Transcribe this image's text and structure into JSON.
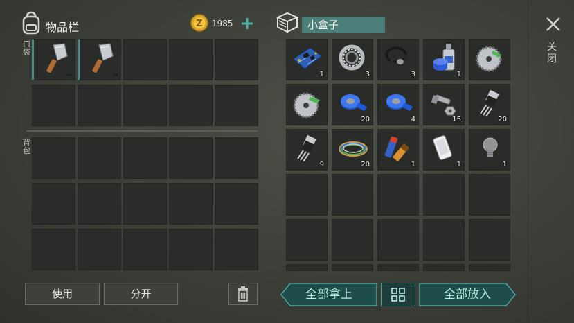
{
  "inventory": {
    "title": "物品栏",
    "coins": "1985",
    "pocket_label": "口袋",
    "backpack_label": "背包",
    "pocket_items": [
      {
        "icon": "cleaver-icon"
      },
      {
        "icon": "cleaver-icon"
      }
    ]
  },
  "container": {
    "title": "小盒子",
    "items": [
      {
        "icon": "circuit-board-icon",
        "qty": "1"
      },
      {
        "icon": "bearing-icon",
        "qty": "3"
      },
      {
        "icon": "rubber-seal-icon",
        "qty": "3"
      },
      {
        "icon": "spray-paint-icon",
        "qty": "1"
      },
      {
        "icon": "saw-blade-icon",
        "qty": ""
      },
      {
        "icon": "saw-blade-icon",
        "qty": ""
      },
      {
        "icon": "tape-icon",
        "qty": "20"
      },
      {
        "icon": "tape-icon",
        "qty": "4"
      },
      {
        "icon": "bolt-icon",
        "qty": "15"
      },
      {
        "icon": "transistor-icon",
        "qty": "20"
      },
      {
        "icon": "transistor-icon",
        "qty": "9"
      },
      {
        "icon": "wires-icon",
        "qty": "20"
      },
      {
        "icon": "batteries-icon",
        "qty": "1"
      },
      {
        "icon": "phone-icon",
        "qty": "1"
      },
      {
        "icon": "light-bulb-icon",
        "qty": "1"
      }
    ]
  },
  "buttons": {
    "use": "使用",
    "split": "分开",
    "take_all": "全部拿上",
    "put_all": "全部放入",
    "close": "关闭"
  },
  "colors": {
    "accent": "#4b7e79",
    "accent_text": "#b8ede4",
    "slot_bg": "#2a2c29"
  }
}
